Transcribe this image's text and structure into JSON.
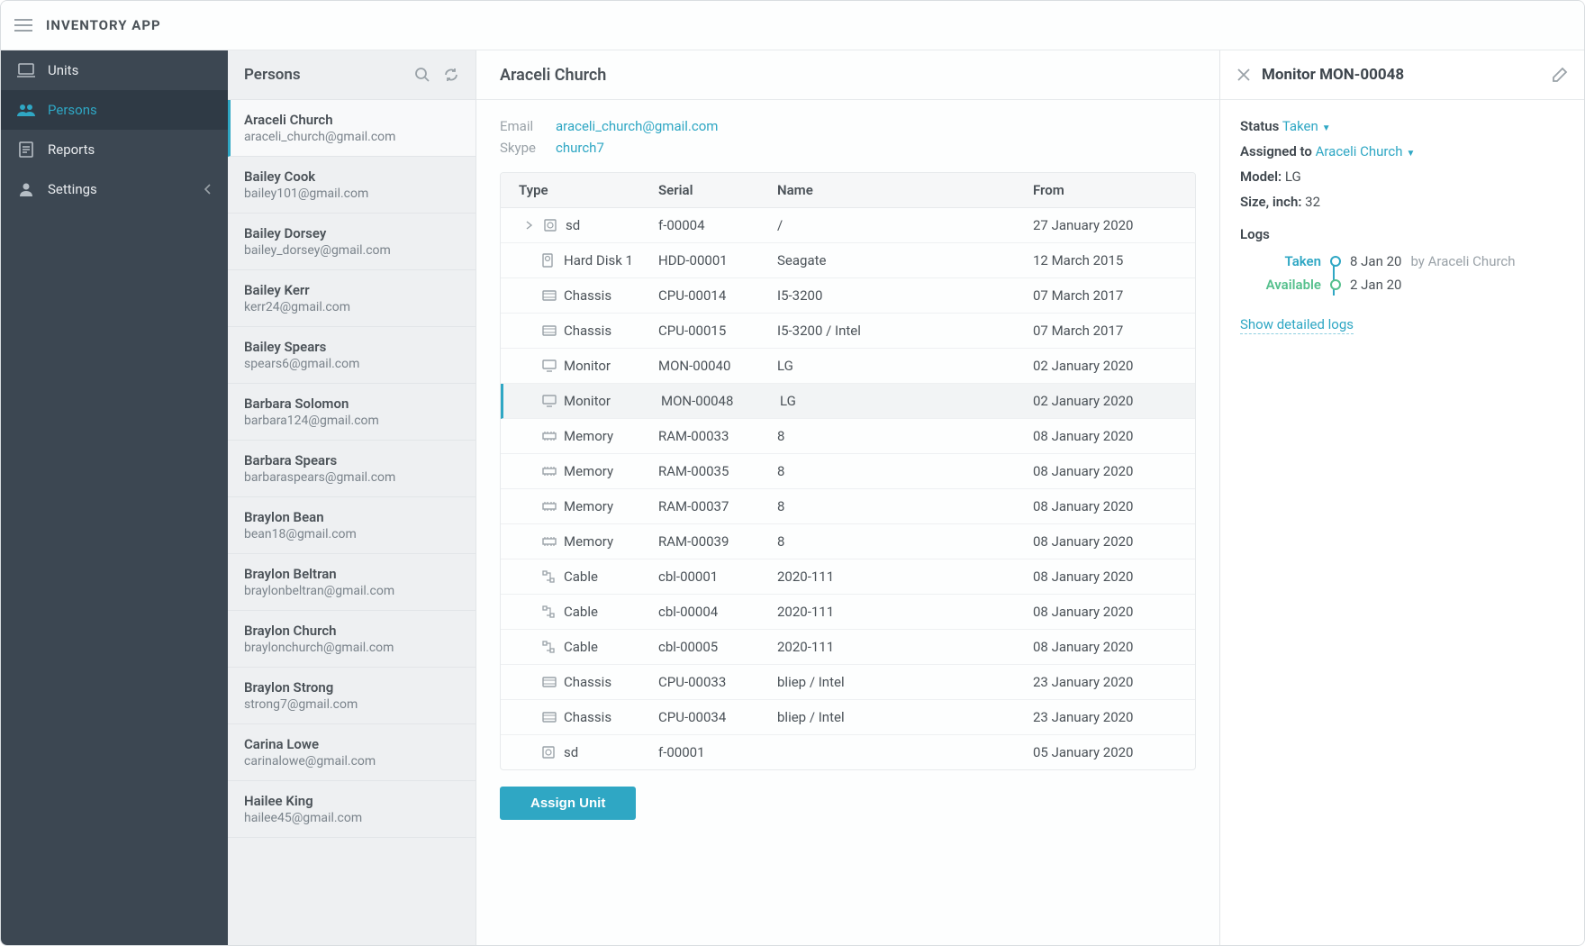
{
  "header": {
    "app_title": "INVENTORY APP"
  },
  "sidebar": {
    "items": [
      {
        "label": "Units",
        "icon": "laptop-icon"
      },
      {
        "label": "Persons",
        "icon": "people-icon"
      },
      {
        "label": "Reports",
        "icon": "report-icon"
      },
      {
        "label": "Settings",
        "icon": "person-icon"
      }
    ]
  },
  "persons_panel": {
    "title": "Persons",
    "items": [
      {
        "name": "Araceli Church",
        "email": "araceli_church@gmail.com",
        "selected": true
      },
      {
        "name": "Bailey Cook",
        "email": "bailey101@gmail.com"
      },
      {
        "name": "Bailey Dorsey",
        "email": "bailey_dorsey@gmail.com"
      },
      {
        "name": "Bailey Kerr",
        "email": "kerr24@gmail.com"
      },
      {
        "name": "Bailey Spears",
        "email": "spears6@gmail.com"
      },
      {
        "name": "Barbara Solomon",
        "email": "barbara124@gmail.com"
      },
      {
        "name": "Barbara Spears",
        "email": "barbaraspears@gmail.com"
      },
      {
        "name": "Braylon Bean",
        "email": "bean18@gmail.com"
      },
      {
        "name": "Braylon Beltran",
        "email": "braylonbeltran@gmail.com"
      },
      {
        "name": "Braylon Church",
        "email": "braylonchurch@gmail.com"
      },
      {
        "name": "Braylon Strong",
        "email": "strong7@gmail.com"
      },
      {
        "name": "Carina Lowe",
        "email": "carinalowe@gmail.com"
      },
      {
        "name": "Hailee King",
        "email": "hailee45@gmail.com"
      }
    ]
  },
  "main": {
    "title": "Araceli Church",
    "meta": {
      "email_label": "Email",
      "email_value": "araceli_church@gmail.com",
      "skype_label": "Skype",
      "skype_value": "church7"
    },
    "table": {
      "columns": {
        "type": "Type",
        "serial": "Serial",
        "name": "Name",
        "from": "From"
      },
      "rows": [
        {
          "type": "sd",
          "icon": "sd-icon",
          "serial": "f-00004",
          "name": "/",
          "from": "27 January 2020",
          "first": true
        },
        {
          "type": "Hard Disk 1",
          "icon": "hdd-icon",
          "serial": "HDD-00001",
          "name": "Seagate",
          "from": "12 March 2015"
        },
        {
          "type": "Chassis",
          "icon": "chassis-icon",
          "serial": "CPU-00014",
          "name": "I5-3200",
          "from": "07 March 2017"
        },
        {
          "type": "Chassis",
          "icon": "chassis-icon",
          "serial": "CPU-00015",
          "name": "I5-3200 / Intel",
          "from": "07 March 2017"
        },
        {
          "type": "Monitor",
          "icon": "monitor-icon",
          "serial": "MON-00040",
          "name": "LG",
          "from": "02 January 2020"
        },
        {
          "type": "Monitor",
          "icon": "monitor-icon",
          "serial": "MON-00048",
          "name": "LG",
          "from": "02 January 2020",
          "selected": true
        },
        {
          "type": "Memory",
          "icon": "memory-icon",
          "serial": "RAM-00033",
          "name": "8",
          "from": "08 January 2020"
        },
        {
          "type": "Memory",
          "icon": "memory-icon",
          "serial": "RAM-00035",
          "name": "8",
          "from": "08 January 2020"
        },
        {
          "type": "Memory",
          "icon": "memory-icon",
          "serial": "RAM-00037",
          "name": "8",
          "from": "08 January 2020"
        },
        {
          "type": "Memory",
          "icon": "memory-icon",
          "serial": "RAM-00039",
          "name": "8",
          "from": "08 January 2020"
        },
        {
          "type": "Cable",
          "icon": "cable-icon",
          "serial": "cbl-00001",
          "name": "2020-111",
          "from": "08 January 2020"
        },
        {
          "type": "Cable",
          "icon": "cable-icon",
          "serial": "cbl-00004",
          "name": "2020-111",
          "from": "08 January 2020"
        },
        {
          "type": "Cable",
          "icon": "cable-icon",
          "serial": "cbl-00005",
          "name": "2020-111",
          "from": "08 January 2020"
        },
        {
          "type": "Chassis",
          "icon": "chassis-icon",
          "serial": "CPU-00033",
          "name": "bliep / Intel",
          "from": "23 January 2020"
        },
        {
          "type": "Chassis",
          "icon": "chassis-icon",
          "serial": "CPU-00034",
          "name": "bliep / Intel",
          "from": "23 January 2020"
        },
        {
          "type": "sd",
          "icon": "sd-icon",
          "serial": "f-00001",
          "name": "",
          "from": "05 January 2020"
        }
      ]
    },
    "assign_button": "Assign Unit"
  },
  "detail": {
    "title": "Monitor MON-00048",
    "status_label": "Status",
    "status_value": "Taken",
    "assigned_label": "Assigned to",
    "assigned_value": "Araceli Church",
    "model_label": "Model:",
    "model_value": "LG",
    "size_label": "Size, inch:",
    "size_value": "32",
    "logs_title": "Logs",
    "logs": [
      {
        "status": "Taken",
        "kind": "taken",
        "date": "8 Jan 20",
        "by_prefix": "by ",
        "by": "Araceli Church"
      },
      {
        "status": "Available",
        "kind": "avail",
        "date": "2 Jan 20"
      }
    ],
    "detailed_logs": "Show detailed logs"
  }
}
